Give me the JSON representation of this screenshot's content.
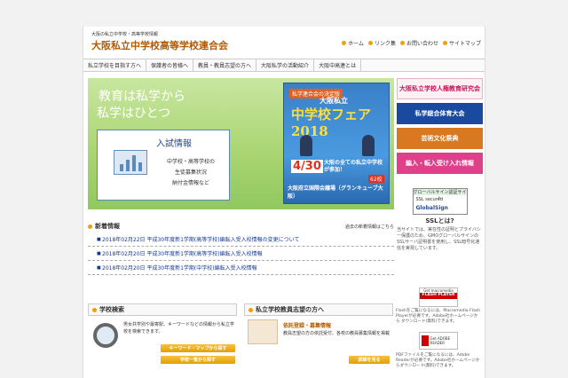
{
  "header": {
    "tagline": "大阪の私立中学校・高等学校情報",
    "title": "大阪私立中学校高等学校連合会",
    "links": [
      "ホーム",
      "リンク集",
      "お問い合わせ",
      "サイトマップ"
    ]
  },
  "nav": [
    "私立学校を目指す方へ",
    "保護者の皆様へ",
    "教員・教員志望の方へ",
    "大阪私学の活動紹介",
    "大阪中高連とは"
  ],
  "hero": {
    "line1": "教育は私学から",
    "line2": "私学はひとつ",
    "exam_heading": "入試情報",
    "exam_lines": [
      "中学校・高等学校の",
      "生徒募集状況",
      "納付金情報など"
    ]
  },
  "fair": {
    "badge": "私学連合会の決定版",
    "name": "中学校フェア2018",
    "subtitle": "大阪私立",
    "date": "4/30",
    "all": "大阪の全ての私立中学校が参加！",
    "count": "62校",
    "venue": "大阪府立国際会議場（グランキューブ大阪）"
  },
  "sidebar": {
    "banners": [
      {
        "label": "大阪私立学校人権教育研究会",
        "color": "#c8185a",
        "bg": "#fdf0f4"
      },
      {
        "label": "私学総合体育大会",
        "color": "#ffffff",
        "bg": "#1a4aa0"
      },
      {
        "label": "芸術文化祭典",
        "color": "#ffffff",
        "bg": "#d87820"
      },
      {
        "label": "編入・転入受け入れ情報",
        "color": "#ffffff",
        "bg": "#e0408a"
      }
    ],
    "ssl_top": "グローバルサイン認証サイト",
    "ssl_secured": "SSL secured",
    "ssl_brand": "GlobalSign",
    "ssl_title": "SSLとは?",
    "ssl_desc": "当サイトでは、実在性の証明とプライバシー保護のため、GMOグローバルサインのSSLサーバ証明書を使用し、SSL暗号化通信を実現しています。"
  },
  "news": {
    "title": "新着情報",
    "past_link": "過去の新着情報はこちら",
    "items": [
      "2018年02月22日 平成30年度新1学期(高等学校)編転入受入校情報の変更について",
      "2018年02月20日 平成30年度新1学期(高等学校)編転入受入校情報",
      "2018年02月20日 平成30年度新1学期(中学校)編転入受入校情報"
    ]
  },
  "school_search": {
    "title": "学校検索",
    "text": "男女共学別や最寄駅、キーワードなどの情報から私立学校を検索できます。",
    "btn1": "キーワード・マップから探す",
    "btn2": "学校一覧から探す"
  },
  "teacher": {
    "title": "私立学校教員志望の方へ",
    "subtitle": "依託登録・募集情報",
    "text": "教員志望の方の依託受付、各校の教員募集情報を掲載",
    "btn": "詳細を見る"
  },
  "flash": {
    "get": "Get macromedia",
    "red": "FLASH PLAYER",
    "note": "Flashをご覧になるには、Macromedia Flash Playerが必要です。Adobe社ホームページから ダウンロード(無料)できます。"
  },
  "adobe": {
    "label": "Get ADOBE READER",
    "note": "PDFファイルをご覧になるには、Adobe Readerが必要です。Adobe社ホームページからダウンロード(無料)できます。"
  }
}
